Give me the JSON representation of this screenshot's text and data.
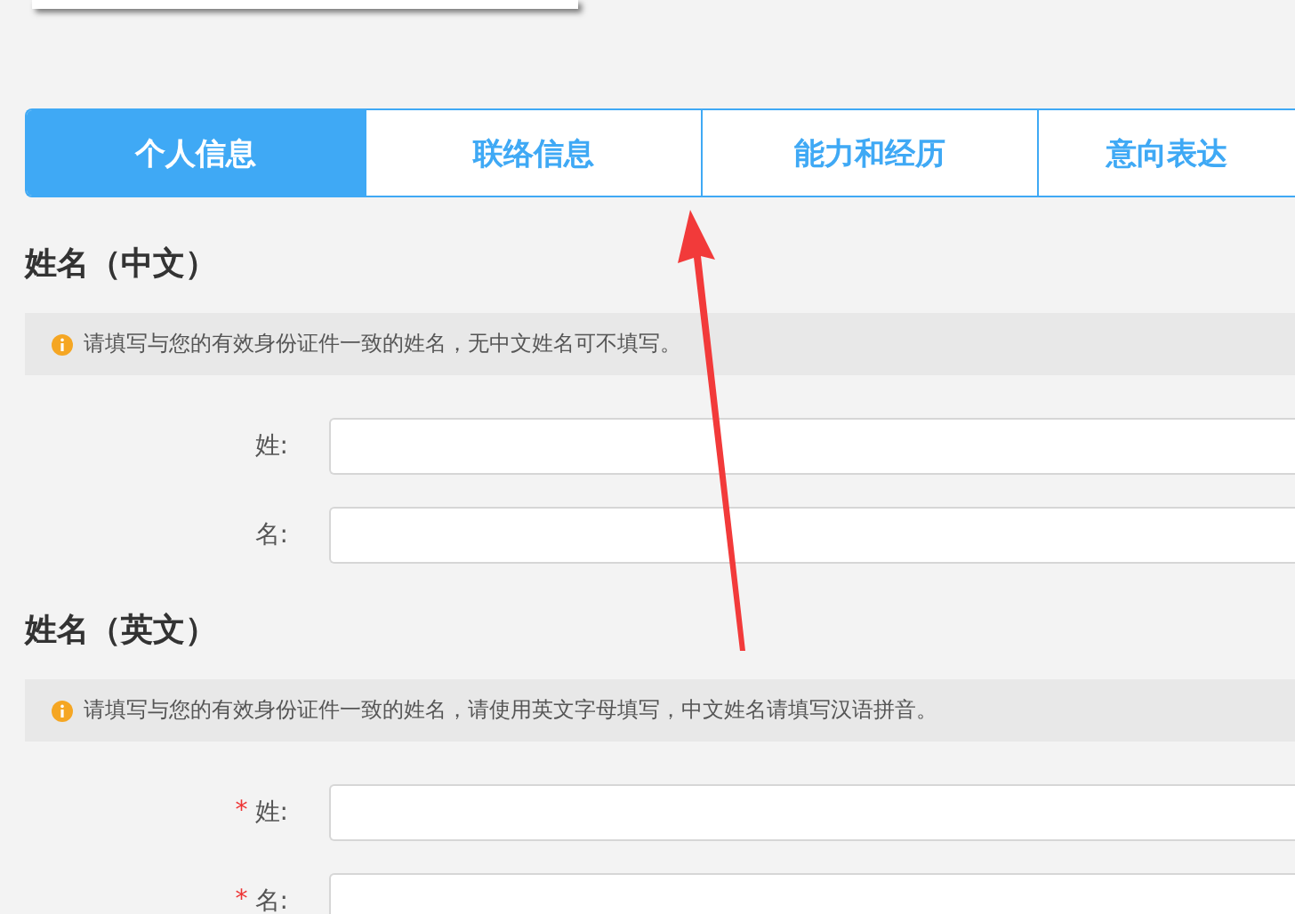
{
  "tabs": [
    {
      "label": "个人信息",
      "selected": true
    },
    {
      "label": "联络信息",
      "selected": false
    },
    {
      "label": "能力和经历",
      "selected": false
    },
    {
      "label": "意向表达",
      "selected": false
    }
  ],
  "sections": [
    {
      "title": "姓名（中文）",
      "hint": "请填写与您的有效身份证件一致的姓名，无中文姓名可不填写。",
      "fields": [
        {
          "label": "姓:"
        },
        {
          "label": "名:"
        }
      ]
    },
    {
      "title": "姓名（英文）",
      "hint": "请填写与您的有效身份证件一致的姓名，请使用英文字母填写，中文姓名请填写汉语拼音。",
      "fields": [
        {
          "label": "姓:",
          "required_mark": "*"
        },
        {
          "label": "名:",
          "required_mark": "*"
        }
      ]
    }
  ]
}
